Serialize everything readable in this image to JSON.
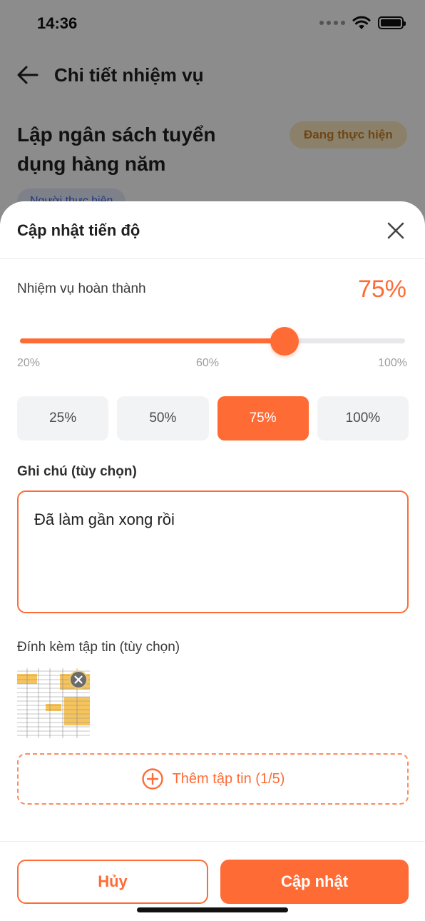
{
  "status_bar": {
    "time": "14:36"
  },
  "background": {
    "header_title": "Chi tiết nhiệm vụ",
    "task_title": "Lập ngân sách tuyển dụng hàng năm",
    "status_badge": "Đang thực hiện",
    "assignee_chip": "Người thực hiện"
  },
  "sheet": {
    "title": "Cập nhật tiến độ",
    "progress_label": "Nhiệm vụ hoàn thành",
    "progress_value_text": "75%",
    "progress_percent": 75,
    "slider_min_value": 20,
    "slider_max_value": 100,
    "slider_ticks": {
      "min": "20%",
      "mid": "60%",
      "max": "100%"
    },
    "presets": [
      {
        "label": "25%",
        "active": false
      },
      {
        "label": "50%",
        "active": false
      },
      {
        "label": "75%",
        "active": true
      },
      {
        "label": "100%",
        "active": false
      }
    ],
    "note_label": "Ghi chú (tùy chọn)",
    "note_value": "Đã làm gần xong rồi",
    "attach_label": "Đính kèm tập tin (tùy chọn)",
    "add_file_label": "Thêm tập tin (1/5)",
    "cancel_label": "Hủy",
    "update_label": "Cập nhật"
  },
  "colors": {
    "accent": "#ff6b35",
    "status_badge_bg": "#fde9c2",
    "status_badge_text": "#c9822a"
  },
  "icons": {
    "back": "arrow-left-icon",
    "close": "close-icon",
    "remove_attachment": "remove-icon",
    "add": "plus-circle-icon"
  }
}
